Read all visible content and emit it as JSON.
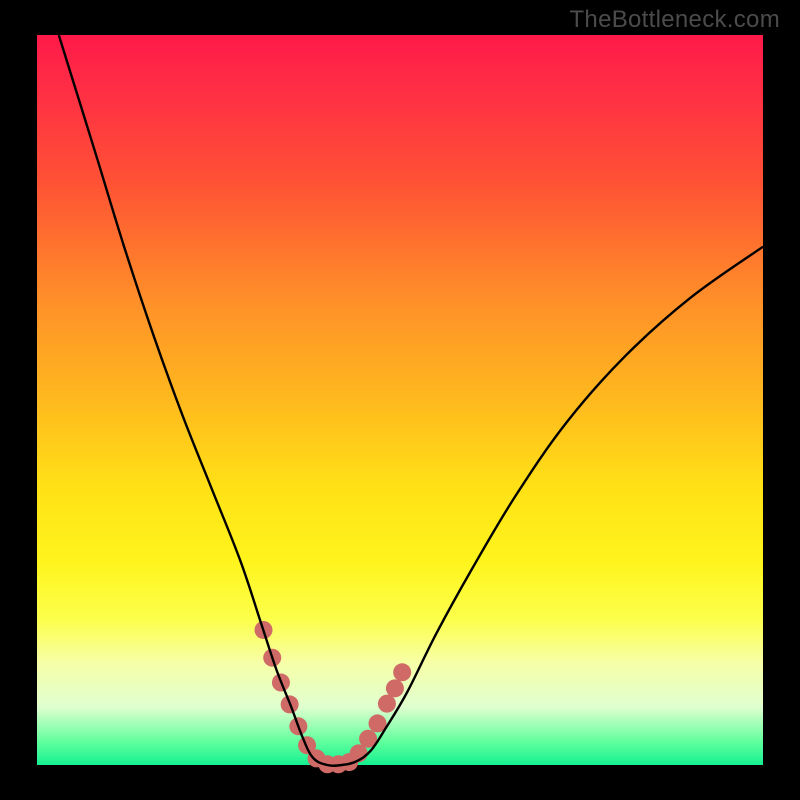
{
  "watermark": "TheBottleneck.com",
  "colors": {
    "curve": "#000000",
    "markers": "#cf6a67",
    "frame": "#000000"
  },
  "chart_data": {
    "type": "line",
    "title": "",
    "xlabel": "",
    "ylabel": "",
    "xlim": [
      0,
      100
    ],
    "ylim": [
      0,
      100
    ],
    "grid": false,
    "legend": false,
    "series": [
      {
        "name": "bottleneck-curve",
        "x": [
          3,
          8,
          12,
          16,
          20,
          24,
          28,
          31,
          33,
          35,
          36.5,
          38,
          40,
          42,
          44,
          46,
          48,
          51,
          55,
          60,
          66,
          73,
          81,
          90,
          100
        ],
        "y": [
          100,
          84,
          71,
          59,
          48,
          38,
          28,
          19,
          13,
          8,
          4,
          1,
          0,
          0,
          0.5,
          2,
          5,
          10,
          18,
          27,
          37,
          47,
          56,
          64,
          71
        ]
      }
    ],
    "markers": {
      "name": "highlight-region",
      "x": [
        31.2,
        32.4,
        33.6,
        34.8,
        36.0,
        37.2,
        38.5,
        40.0,
        41.5,
        43.0,
        44.3,
        45.6,
        46.9,
        48.2,
        49.3,
        50.3
      ],
      "y": [
        18.5,
        14.7,
        11.3,
        8.3,
        5.3,
        2.7,
        0.9,
        0.1,
        0.1,
        0.4,
        1.6,
        3.6,
        5.7,
        8.4,
        10.5,
        12.7
      ]
    }
  }
}
